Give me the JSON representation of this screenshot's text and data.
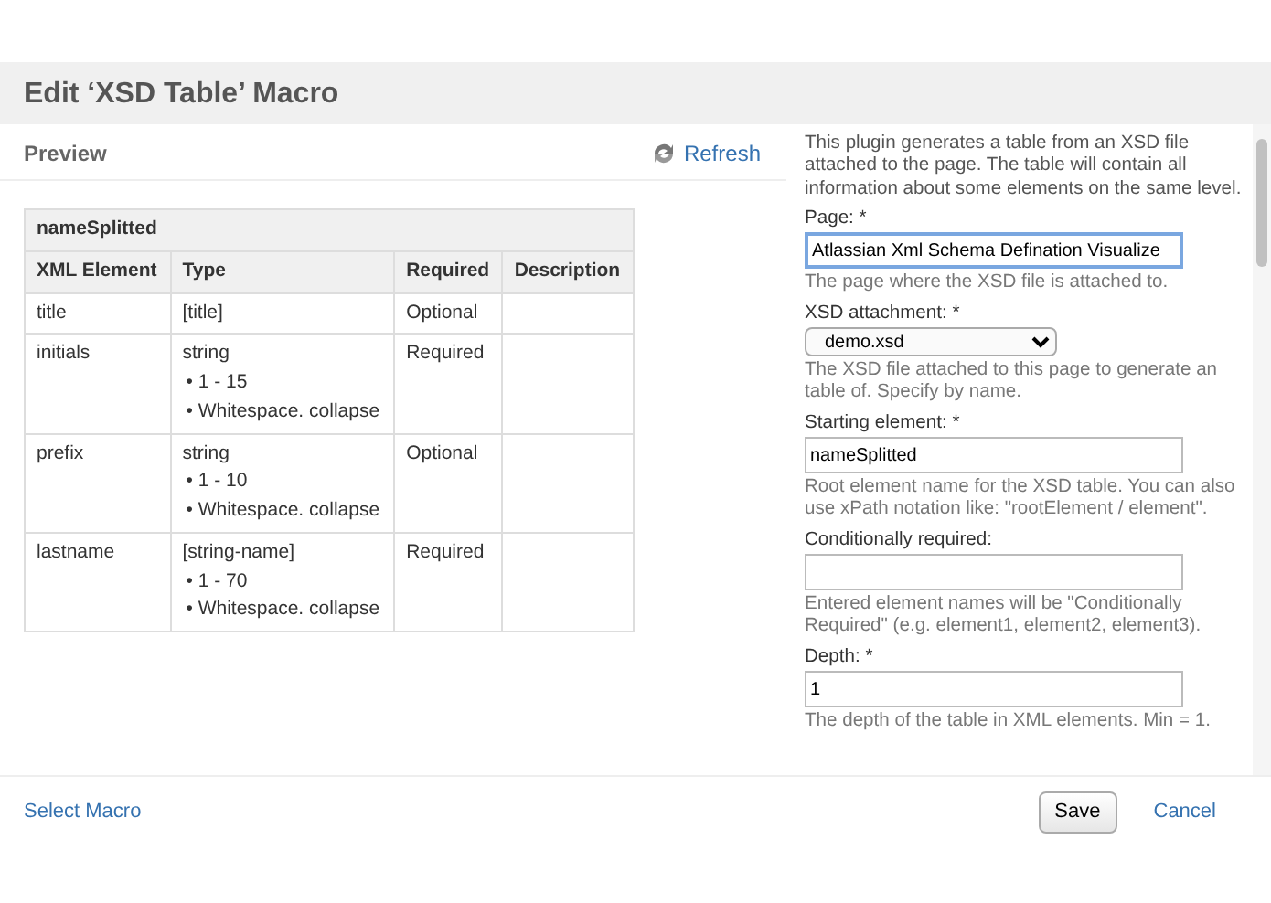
{
  "dialog": {
    "title": "Edit ‘XSD Table’ Macro"
  },
  "preview": {
    "heading": "Preview",
    "refresh": "Refresh",
    "table": {
      "caption": "nameSplitted",
      "columns": [
        "XML Element",
        "Type",
        "Required",
        "Description"
      ],
      "rows": [
        {
          "element": "title",
          "type": "[title]",
          "facets": [],
          "required": "Optional",
          "description": ""
        },
        {
          "element": "initials",
          "type": "string",
          "facets": [
            "• 1 - 15",
            "• Whitespace. collapse"
          ],
          "required": "Required",
          "description": ""
        },
        {
          "element": "prefix",
          "type": "string",
          "facets": [
            "• 1 - 10",
            "• Whitespace. collapse"
          ],
          "required": "Optional",
          "description": ""
        },
        {
          "element": "lastname",
          "type": "[string-name]",
          "facets": [
            "• 1 - 70",
            "• Whitespace. collapse"
          ],
          "required": "Required",
          "description": ""
        }
      ]
    }
  },
  "form": {
    "intro": "This plugin generates a table from an XSD file attached to the page. The table will contain all information about some elements on the same level.",
    "fields": [
      {
        "kind": "text",
        "label": "Page: *",
        "value": "Atlassian Xml Schema Defination Visualize",
        "focused": true,
        "help": "The page where the XSD file is attached to."
      },
      {
        "kind": "select",
        "label": "XSD attachment: *",
        "value": "demo.xsd",
        "help": "The XSD file attached to this page to generate an table of. Specify by name."
      },
      {
        "kind": "text",
        "label": "Starting element: *",
        "value": "nameSplitted",
        "help": "Root element name for the XSD table. You can also use xPath notation like: \"rootElement / element\"."
      },
      {
        "kind": "text",
        "label": "Conditionally required:",
        "help": "Entered element names will be \"Conditionally Required\" (e.g. element1, element2, element3)."
      },
      {
        "kind": "text",
        "label": "Depth: *",
        "value": "1",
        "help": "The depth of the table in XML elements. Min = 1."
      }
    ]
  },
  "footer": {
    "select_macro": "Select Macro",
    "save": "Save",
    "cancel": "Cancel"
  }
}
